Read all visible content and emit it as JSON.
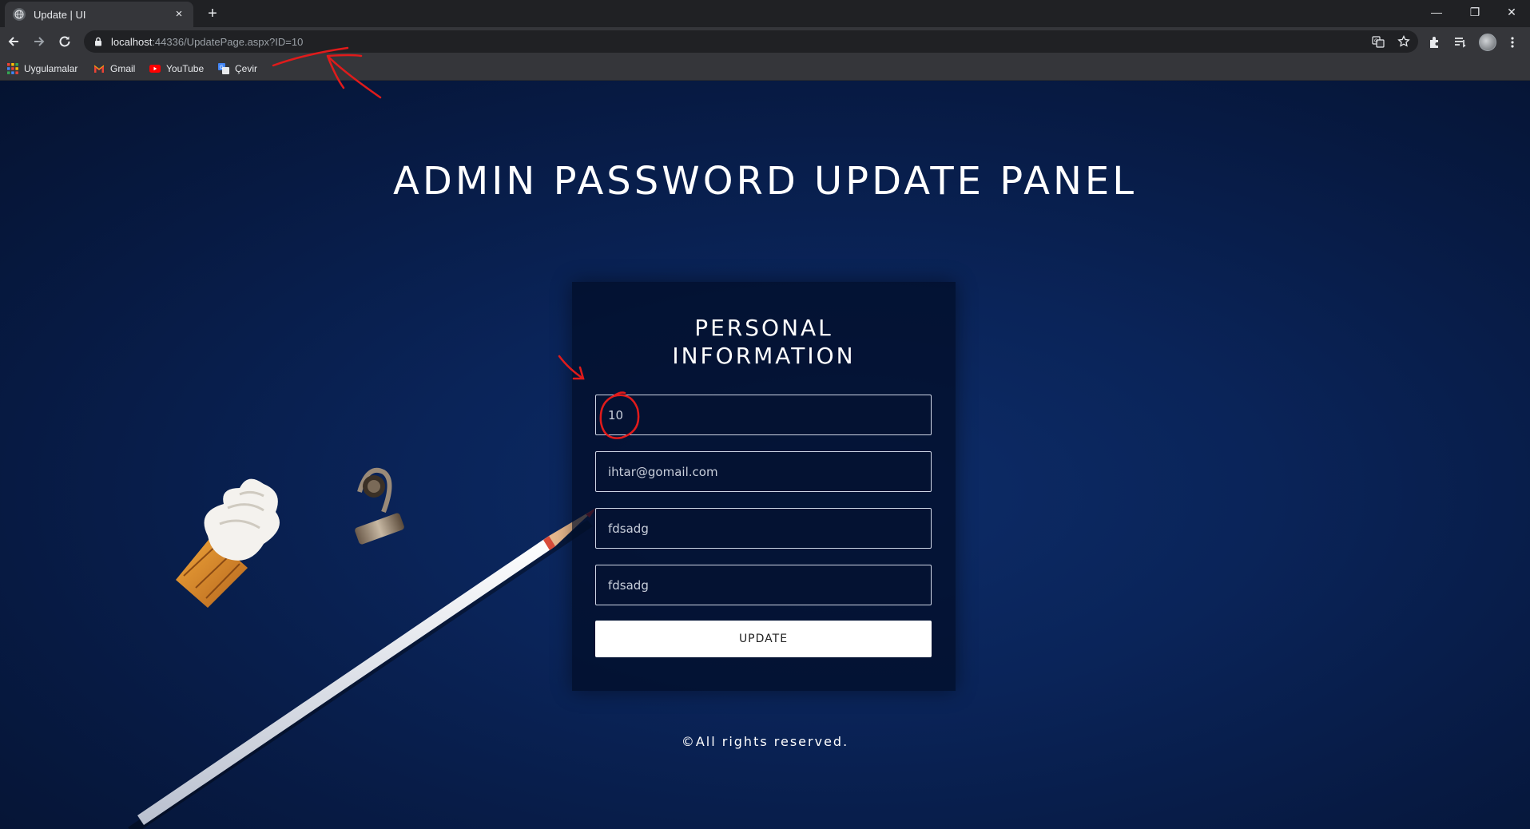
{
  "browser": {
    "tab_title": "Update | UI",
    "tab_close": "×",
    "new_tab": "+",
    "url_host": "localhost",
    "url_rest": ":44336/UpdatePage.aspx?ID=10",
    "window_controls": {
      "minimize": "—",
      "restore": "❐",
      "close": "✕"
    }
  },
  "bookmarks": [
    {
      "label": "Uygulamalar",
      "icon": "apps-grid-icon"
    },
    {
      "label": "Gmail",
      "icon": "gmail-icon"
    },
    {
      "label": "YouTube",
      "icon": "youtube-icon"
    },
    {
      "label": "Çevir",
      "icon": "translate-icon"
    }
  ],
  "page": {
    "title": "ADMIN PASSWORD UPDATE PANEL",
    "card_title_line1": "PERSONAL",
    "card_title_line2": "INFORMATION",
    "fields": [
      {
        "value": "10"
      },
      {
        "value": "ihtar@gomail.com"
      },
      {
        "value": "fdsadg"
      },
      {
        "value": "fdsadg"
      }
    ],
    "update_label": "UPDATE",
    "footer": "©All rights reserved."
  },
  "colors": {
    "background": "#0a2459",
    "annotation": "#e01b1b",
    "button": "#ffffff"
  }
}
